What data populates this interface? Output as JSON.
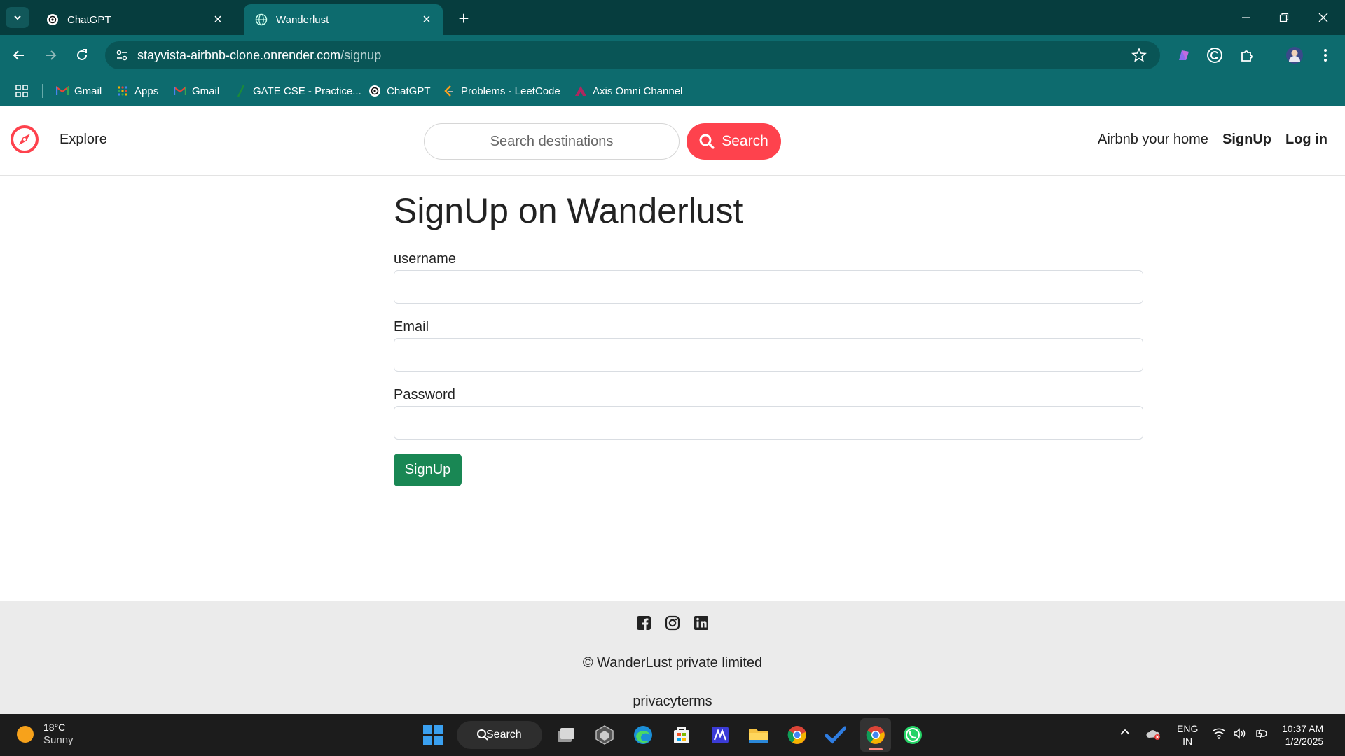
{
  "browser": {
    "tabs": [
      {
        "title": "ChatGPT",
        "active": false,
        "icon": "chatgpt-icon"
      },
      {
        "title": "Wanderlust",
        "active": true,
        "icon": "globe-icon"
      }
    ],
    "url_host": "stayvista-airbnb-clone.onrender.com",
    "url_path": "/signup",
    "bookmarks": [
      {
        "label": "Gmail",
        "icon": "gmail-icon"
      },
      {
        "label": "Apps",
        "icon": "apps-grid-icon"
      },
      {
        "label": "Gmail",
        "icon": "gmail-icon"
      },
      {
        "label": "GATE CSE - Practice...",
        "icon": "gate-icon"
      },
      {
        "label": "ChatGPT",
        "icon": "chatgpt-icon"
      },
      {
        "label": "Problems - LeetCode",
        "icon": "leetcode-icon"
      },
      {
        "label": "Axis Omni Channel",
        "icon": "axis-icon"
      }
    ]
  },
  "navbar": {
    "explore": "Explore",
    "search_placeholder": "Search destinations",
    "search_button": "Search",
    "host_link": "Airbnb your home",
    "signup_link": "SignUp",
    "login_link": "Log in",
    "accent_color": "#fe424d"
  },
  "form": {
    "title": "SignUp on Wanderlust",
    "username_label": "username",
    "email_label": "Email",
    "password_label": "Password",
    "submit_label": "SignUp",
    "submit_color": "#198754"
  },
  "footer": {
    "socials": [
      "facebook-icon",
      "instagram-icon",
      "linkedin-icon"
    ],
    "copyright": "© WanderLust private limited",
    "policy_links": "privacyterms"
  },
  "taskbar": {
    "temperature": "18°C",
    "condition": "Sunny",
    "search_label": "Search",
    "lang_line1": "ENG",
    "lang_line2": "IN",
    "time": "10:37 AM",
    "date": "1/2/2025"
  }
}
